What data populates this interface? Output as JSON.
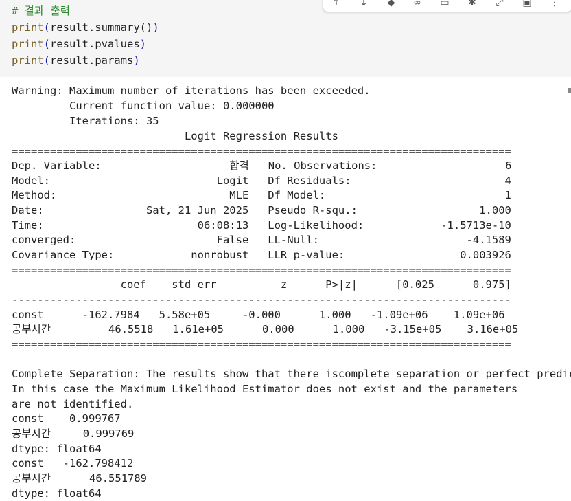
{
  "code": {
    "comment": "# 결과 출력",
    "lines": [
      {
        "fn": "print",
        "arg": "result.summary()"
      },
      {
        "fn": "print",
        "arg": "result.pvalues"
      },
      {
        "fn": "print",
        "arg": "result.params"
      }
    ]
  },
  "toolbar": {
    "icons": [
      "arrow-up-icon",
      "arrow-down-icon",
      "tag-icon",
      "link-icon",
      "comment-icon",
      "gear-icon",
      "expand-icon",
      "delete-icon",
      "more-icon"
    ]
  },
  "output": {
    "lines": [
      "Warning: Maximum number of iterations has been exceeded.",
      "         Current function value: 0.000000",
      "         Iterations: 35",
      "                           Logit Regression Results",
      "==============================================================================",
      "Dep. Variable:                    합격   No. Observations:                    6",
      "Model:                          Logit   Df Residuals:                        4",
      "Method:                           MLE   Df Model:                            1",
      "Date:                Sat, 21 Jun 2025   Pseudo R-squ.:                   1.000",
      "Time:                        06:08:13   Log-Likelihood:            -1.5713e-10",
      "converged:                      False   LL-Null:                       -4.1589",
      "Covariance Type:            nonrobust   LLR p-value:                  0.003926",
      "==============================================================================",
      "                 coef    std err          z      P>|z|      [0.025      0.975]",
      "------------------------------------------------------------------------------",
      "const      -162.7984   5.58e+05     -0.000      1.000   -1.09e+06    1.09e+06",
      "공부시간         46.5518   1.61e+05      0.000      1.000   -3.15e+05    3.16e+05",
      "==============================================================================",
      "",
      "Complete Separation: The results show that there iscomplete separation or perfect predicti",
      "In this case the Maximum Likelihood Estimator does not exist and the parameters",
      "are not identified.",
      "const    0.999767",
      "공부시간     0.999769",
      "dtype: float64",
      "const   -162.798412",
      "공부시간      46.551789",
      "dtype: float64"
    ]
  }
}
